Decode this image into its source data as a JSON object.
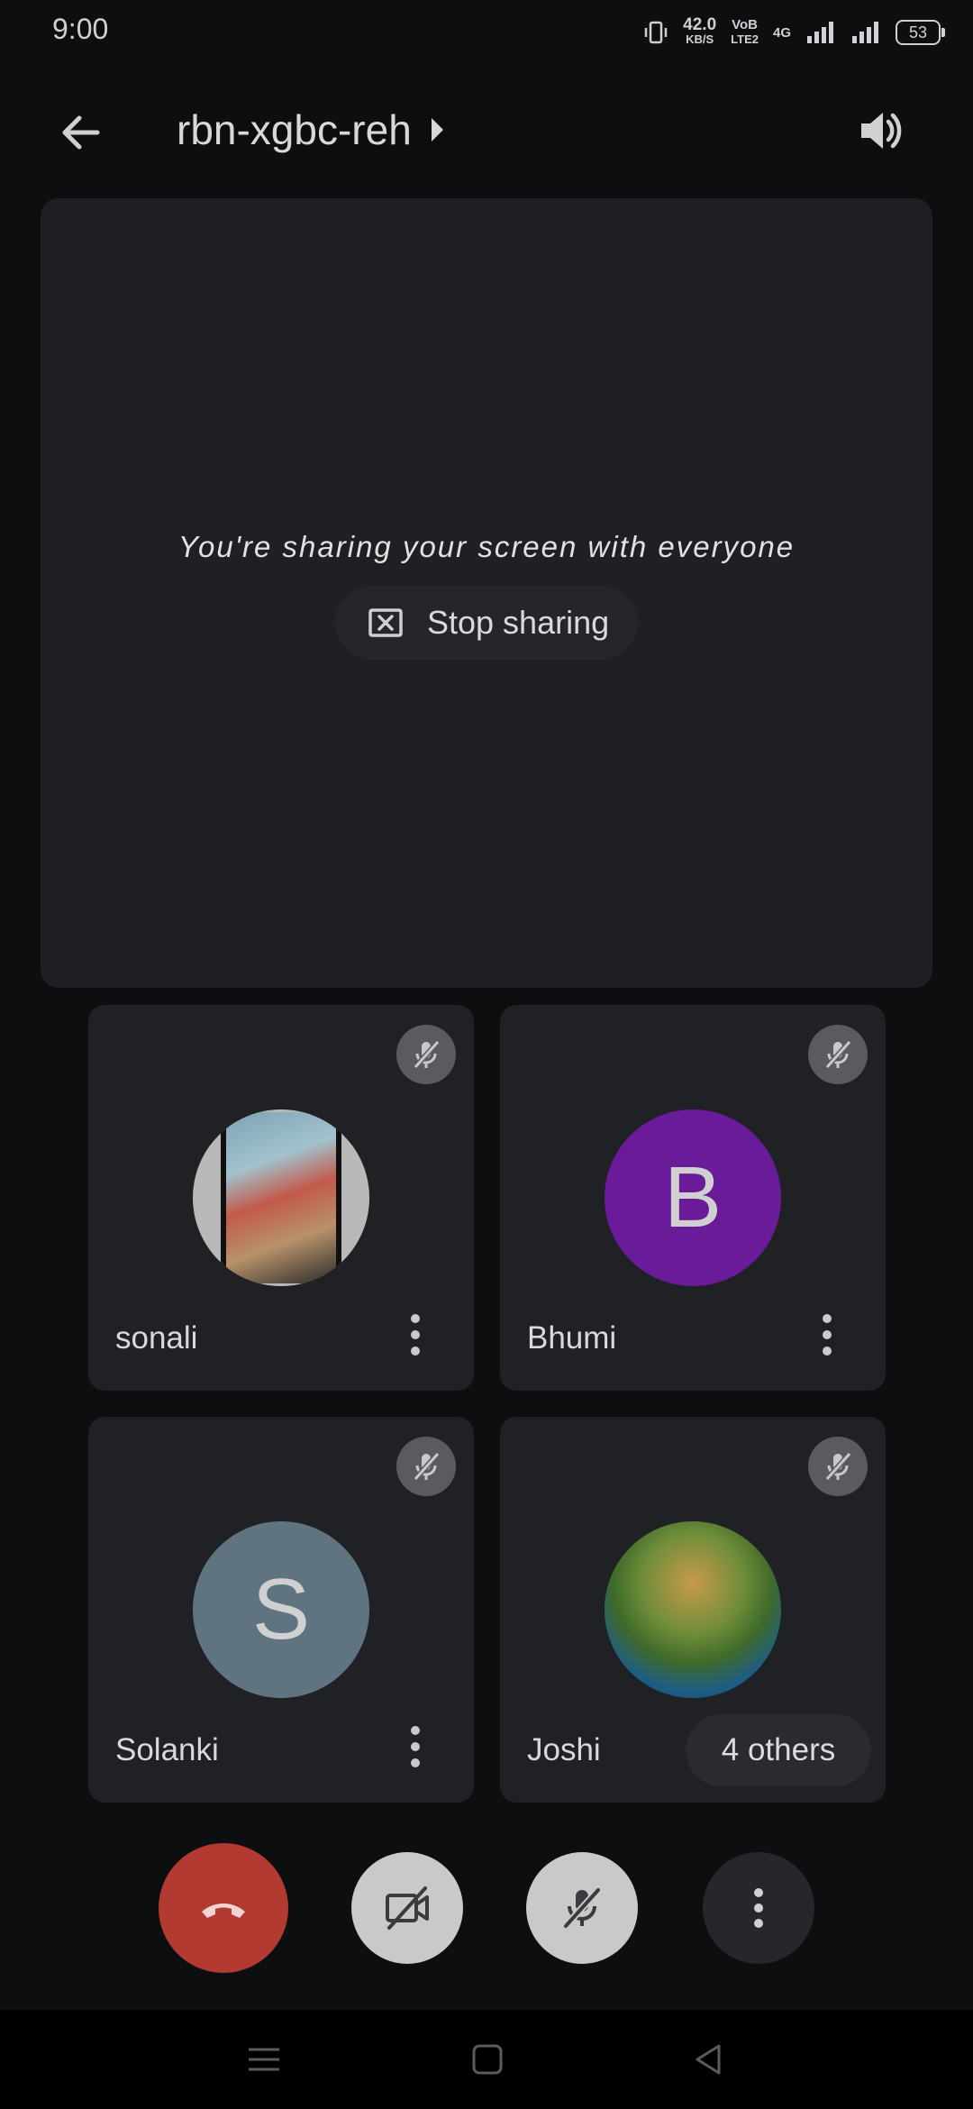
{
  "status_bar": {
    "time": "9:00",
    "net_speed": "42.0",
    "net_unit": "KB/S",
    "volte_top": "VoB",
    "volte_bottom": "LTE2",
    "network": "4G",
    "battery": "53"
  },
  "header": {
    "meeting_code": "rbn-xgbc-reh"
  },
  "share": {
    "message": "You're sharing your screen with everyone",
    "stop_label": "Stop sharing"
  },
  "participants": [
    {
      "name": "sonali",
      "avatar_type": "photo"
    },
    {
      "name": "Bhumi",
      "initial": "B",
      "avatar_color": "#6a1b9a"
    },
    {
      "name": "Solanki",
      "initial": "S",
      "avatar_color": "#5f7480"
    },
    {
      "name": "Joshi",
      "avatar_type": "photo"
    }
  ],
  "others_label": "4 others",
  "colors": {
    "end_call": "#b23a30",
    "tile_bg": "#202125",
    "panel_bg": "#1f2024"
  },
  "icons": {
    "back": "arrow-left-icon",
    "speaker": "speaker-volume-icon",
    "stop_share": "stop-screen-share-icon",
    "mic_off": "mic-off-icon",
    "camera_off": "camera-off-icon",
    "end_call": "phone-hangup-icon",
    "more": "more-vertical-icon"
  }
}
